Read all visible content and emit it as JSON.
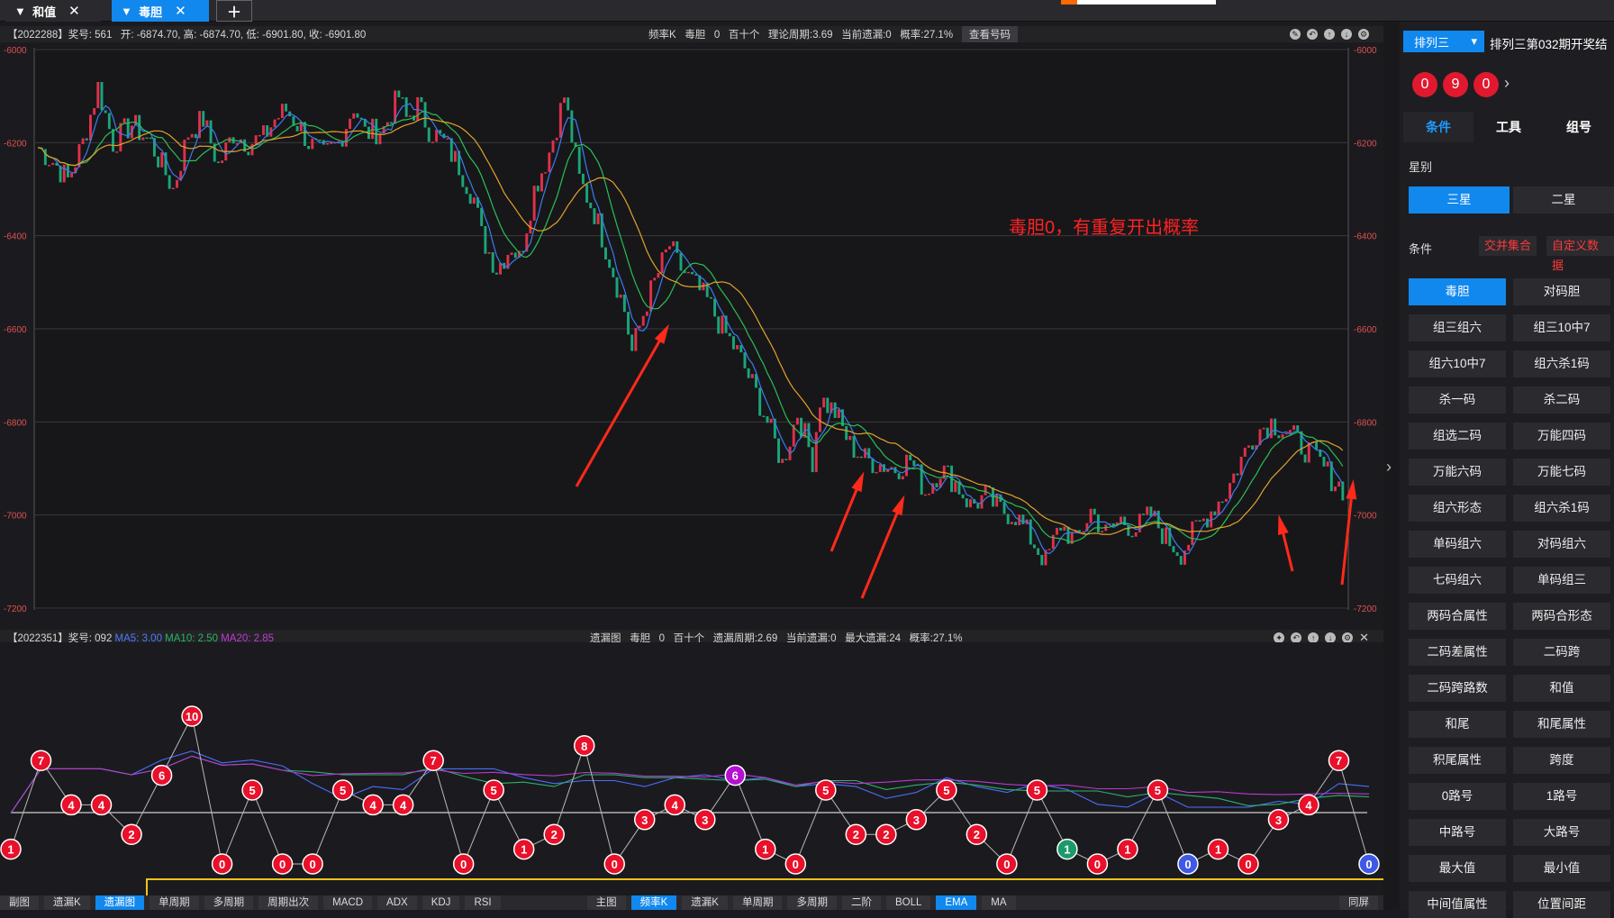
{
  "tabs": [
    {
      "label": "和值"
    },
    {
      "label": "毒胆"
    }
  ],
  "kline": {
    "info_left": "【2022288】奖号: 561   开: -6874.70, 高: -6874.70, 低: -6901.80, 收: -6901.80",
    "info_center": "频率K   毒胆   0   百十个   理论周期:3.69   当前遗漏:0   概率:27.1%",
    "view_button": "查看号码",
    "y_ticks": [
      -6000,
      -6200,
      -6400,
      -6600,
      -6800,
      -7000,
      -7200
    ],
    "annotation": "毒胆0，有重复开出概率",
    "colors": {
      "up": "#e0304a",
      "down": "#1aa57a",
      "ma_fast": "#3a7df0",
      "ma_mid": "#2bbf55",
      "ma_slow": "#e2a227",
      "annotation": "#ff2222",
      "arrows": "#ff2a1a"
    }
  },
  "missing_chart": {
    "info_left": "【2022351】奖号: 092 ",
    "ma5_label": "MA5: 3.00",
    "ma10_label": "MA10: 2.50",
    "ma20_label": "MA20: 2.85",
    "info_center": "遗漏图   毒胆   0   百十个   遗漏周期:2.69   当前遗漏:0   最大遗漏:24   概率:27.1%"
  },
  "chart_data": [
    {
      "type": "line",
      "title": "频率K 毒胆 0 百十个",
      "ylim": [
        -7200,
        -6000
      ],
      "series": [
        {
          "name": "MA5"
        },
        {
          "name": "MA10"
        },
        {
          "name": "MA20"
        }
      ],
      "anchor_x": [
        0,
        4,
        8,
        12,
        16,
        20,
        25,
        30,
        36,
        40,
        44,
        48,
        52,
        56,
        60,
        63,
        66,
        70,
        72,
        76,
        80,
        84,
        87,
        92,
        96,
        98,
        101,
        104,
        108,
        112,
        116,
        118,
        122,
        126,
        128,
        132,
        136,
        140,
        144,
        148,
        152,
        156,
        158,
        162,
        164,
        168,
        170,
        174,
        178,
        182,
        186,
        190,
        194,
        198,
        202,
        206,
        208,
        212,
        216,
        220,
        224,
        228,
        232,
        236,
        240,
        244,
        248,
        252,
        256,
        260,
        264,
        268,
        272,
        276,
        280,
        284,
        288,
        292,
        296,
        300,
        304,
        308,
        312,
        316,
        320,
        324,
        328,
        332,
        336,
        340,
        344,
        348
      ],
      "anchor_y": [
        -6210,
        -6240,
        -6280,
        -6200,
        -6080,
        -6200,
        -6160,
        -6200,
        -6300,
        -6180,
        -6150,
        -6250,
        -6180,
        -6200,
        -6190,
        -6150,
        -6130,
        -6170,
        -6200,
        -6230,
        -6200,
        -6120,
        -6180,
        -6170,
        -6100,
        -6150,
        -6120,
        -6170,
        -6200,
        -6250,
        -6320,
        -6400,
        -6470,
        -6420,
        -6450,
        -6300,
        -6220,
        -6100,
        -6280,
        -6350,
        -6450,
        -6560,
        -6650,
        -6540,
        -6500,
        -6420,
        -6460,
        -6500,
        -6540,
        -6600,
        -6650,
        -6720,
        -6800,
        -6890,
        -6780,
        -6880,
        -6750,
        -6780,
        -6850,
        -6880,
        -6890,
        -6900,
        -6880,
        -6950,
        -6900,
        -6930,
        -6980,
        -6960,
        -6990,
        -7000,
        -7050,
        -7100,
        -7020,
        -7060,
        -6990,
        -7040,
        -7010,
        -7030,
        -7000,
        -7050,
        -7080,
        -7030,
        -6990,
        -6950,
        -6880,
        -6820,
        -6800,
        -6820,
        -6850,
        -6880,
        -6920,
        -6950
      ],
      "candle_count": 348
    },
    {
      "type": "line",
      "title": "遗漏图 毒胆 0 百十个",
      "series": [
        {
          "name": "遗漏",
          "values": [
            1,
            7,
            4,
            4,
            2,
            6,
            10,
            0,
            5,
            0,
            0,
            5,
            4,
            4,
            7,
            0,
            5,
            1,
            2,
            8,
            0,
            3,
            4,
            3,
            6,
            1,
            0,
            5,
            2,
            2,
            3,
            5,
            2,
            0,
            5,
            1,
            0,
            1,
            5,
            0,
            1,
            0,
            3,
            4,
            7,
            0
          ]
        }
      ],
      "ball_colors": {
        "red": "#e8102a",
        "purple": "#b40fd2",
        "green": "#1b9a6a",
        "blue": "#3f59e6"
      },
      "special": {
        "24": "purple",
        "35": "green",
        "39": "blue",
        "45": "blue"
      }
    }
  ],
  "bottom_tabs_left": [
    "副图",
    "遗漏K",
    "遗漏图",
    "单周期",
    "多周期",
    "周期出次",
    "MACD",
    "ADX",
    "KDJ",
    "RSI"
  ],
  "bottom_tabs_right": [
    "主图",
    "频率K",
    "遗漏K",
    "单周期",
    "多周期",
    "二阶",
    "BOLL",
    "EMA",
    "MA"
  ],
  "bottom_right_btn": "同屏",
  "side": {
    "select": "排列三",
    "period": "排列三第032期开奖结",
    "balls": [
      "0",
      "9",
      "0"
    ],
    "tabs": [
      "条件",
      "工具",
      "组号"
    ],
    "star_label": "星别",
    "stars": [
      "三星",
      "二星"
    ],
    "cond_label": "条件",
    "cond_links": [
      "交并集合",
      "自定义数据"
    ],
    "conditions": [
      "毒胆",
      "对码胆",
      "组三组六",
      "组三10中7",
      "组六10中7",
      "组六杀1码",
      "杀一码",
      "杀二码",
      "组选二码",
      "万能四码",
      "万能六码",
      "万能七码",
      "组六形态",
      "组六杀1码",
      "单码组六",
      "对码组六",
      "七码组六",
      "单码组三",
      "两码合属性",
      "两码合形态",
      "二码差属性",
      "二码跨",
      "二码跨路数",
      "和值",
      "和尾",
      "和尾属性",
      "积尾属性",
      "跨度",
      "0路号",
      "1路号",
      "中路号",
      "大路号",
      "最大值",
      "最小值",
      "中间值属性",
      "位置间距"
    ]
  }
}
